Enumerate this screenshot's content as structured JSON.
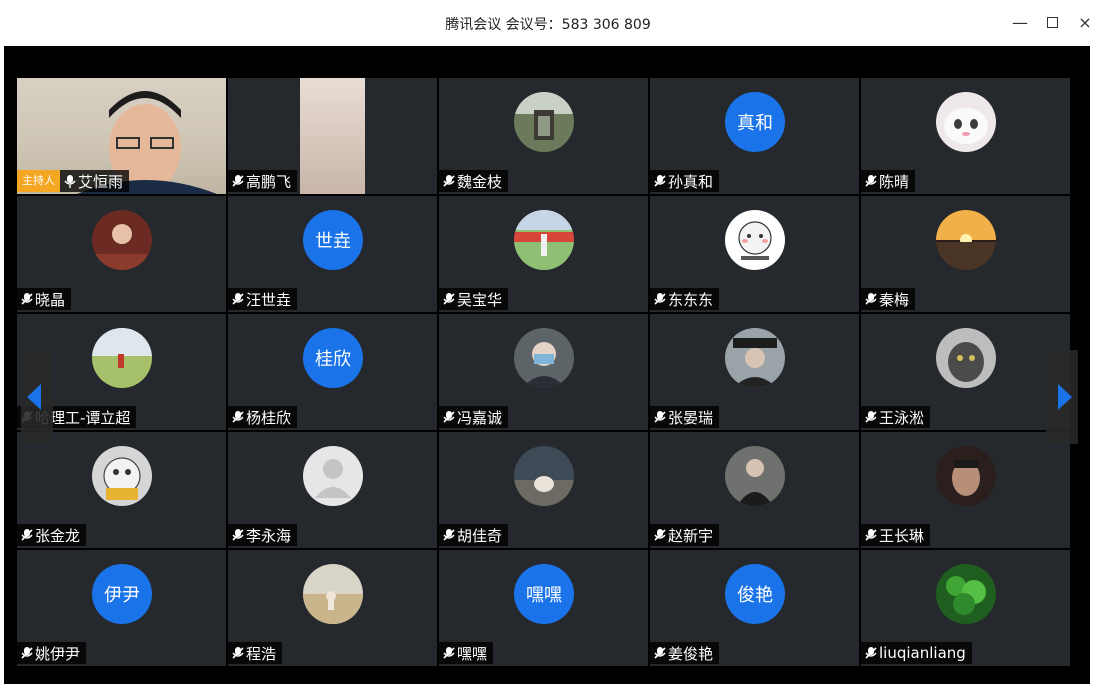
{
  "window": {
    "title": "腾讯会议 会议号：583 306 809",
    "controls": {
      "minimize": "—",
      "maximize": "",
      "close": "×"
    }
  },
  "host_badge": "主持人",
  "colors": {
    "avatar_blue": "#1a73e8",
    "host_orange": "#f5a623",
    "tile_bg": "#25282c"
  },
  "participants": [
    {
      "name": "艾恒雨",
      "kind": "video",
      "host": true,
      "mic": "on"
    },
    {
      "name": "高鹏飞",
      "kind": "video2",
      "mic": "muted"
    },
    {
      "name": "魏金枝",
      "kind": "photo",
      "photo": "garden",
      "mic": "muted"
    },
    {
      "name": "孙真和",
      "kind": "text",
      "initials": "真和",
      "mic": "muted"
    },
    {
      "name": "陈晴",
      "kind": "photo",
      "photo": "cat",
      "mic": "muted"
    },
    {
      "name": "晓晶",
      "kind": "photo",
      "photo": "woman",
      "mic": "muted"
    },
    {
      "name": "汪世垚",
      "kind": "text",
      "initials": "世垚",
      "mic": "muted"
    },
    {
      "name": "吴宝华",
      "kind": "photo",
      "photo": "flowers",
      "mic": "muted"
    },
    {
      "name": "东东东",
      "kind": "photo",
      "photo": "sticker",
      "mic": "muted"
    },
    {
      "name": "秦梅",
      "kind": "photo",
      "photo": "sunset",
      "mic": "muted"
    },
    {
      "name": "哈理工-谭立超",
      "kind": "photo",
      "photo": "field",
      "mic": "muted"
    },
    {
      "name": "杨桂欣",
      "kind": "text",
      "initials": "桂欣",
      "mic": "muted"
    },
    {
      "name": "冯嘉诚",
      "kind": "photo",
      "photo": "mask",
      "mic": "muted"
    },
    {
      "name": "张晏瑞",
      "kind": "photo",
      "photo": "grad",
      "mic": "muted"
    },
    {
      "name": "王泳淞",
      "kind": "photo",
      "photo": "graycat",
      "mic": "muted"
    },
    {
      "name": "张金龙",
      "kind": "photo",
      "photo": "cartoon",
      "mic": "muted"
    },
    {
      "name": "李永海",
      "kind": "photo",
      "photo": "default",
      "mic": "muted"
    },
    {
      "name": "胡佳奇",
      "kind": "photo",
      "photo": "dog",
      "mic": "muted"
    },
    {
      "name": "赵新宇",
      "kind": "photo",
      "photo": "man",
      "mic": "muted"
    },
    {
      "name": "王长琳",
      "kind": "photo",
      "photo": "face",
      "mic": "muted"
    },
    {
      "name": "姚伊尹",
      "kind": "text",
      "initials": "伊尹",
      "mic": "muted"
    },
    {
      "name": "程浩",
      "kind": "photo",
      "photo": "beach",
      "mic": "muted"
    },
    {
      "name": "嘿嘿",
      "kind": "text",
      "initials": "嘿嘿",
      "mic": "muted"
    },
    {
      "name": "姜俊艳",
      "kind": "text",
      "initials": "俊艳",
      "mic": "muted"
    },
    {
      "name": "liuqianliang",
      "kind": "photo",
      "photo": "plant",
      "mic": "muted"
    }
  ]
}
